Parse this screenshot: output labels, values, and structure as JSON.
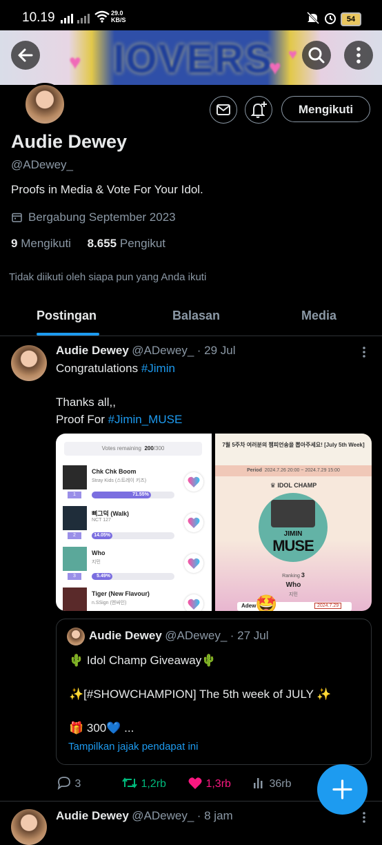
{
  "status_bar": {
    "time": "10.19",
    "net_speed_value": "29.0",
    "net_speed_unit": "KB/S",
    "battery": "54"
  },
  "banner": {
    "text": "IOVERS"
  },
  "profile": {
    "name": "Audie Dewey",
    "handle": "@ADewey_",
    "bio": "Proofs in Media & Vote For Your Idol.",
    "joined": "Bergabung September 2023",
    "following_count": "9",
    "following_label": "Mengikuti",
    "followers_count": "8.655",
    "followers_label": "Pengikut",
    "follow_button": "Mengikuti",
    "followed_by": "Tidak diikuti oleh siapa pun yang Anda ikuti"
  },
  "tabs": [
    "Postingan",
    "Balasan",
    "Media"
  ],
  "tweet": {
    "name": "Audie Dewey",
    "handle": "@ADewey_",
    "date": "· 29 Jul",
    "line1_prefix": "Congratulations ",
    "line1_tag": "#Jimin",
    "line2": "Thanks all,,",
    "line3_prefix": "Proof For ",
    "line3_tag": "#Jimin_MUSE",
    "media_left": {
      "votes_label": "Votes remaining",
      "votes_value": "200",
      "votes_total": "/300",
      "rows": [
        {
          "rank": "1",
          "title": "Chk Chk Boom",
          "artist": "Stray Kids (스트레이 키즈)",
          "pct": "71.55%",
          "frac": 0.7155
        },
        {
          "rank": "2",
          "title": "삐그덕 (Walk)",
          "artist": "NCT 127",
          "pct": "14.05%",
          "frac": 0.1405
        },
        {
          "rank": "3",
          "title": "Who",
          "artist": "지민",
          "pct": "5.49%",
          "frac": 0.0549
        },
        {
          "rank": "",
          "title": "Tiger (New Flavour)",
          "artist": "n.SSign (엔싸인)",
          "pct": "",
          "frac": 0
        }
      ]
    },
    "media_right": {
      "header": "7월 5주차 여러분의 챔피언송을 뽑아주세요! [July 5th Week]",
      "period_label": "Period",
      "period_value": "2024.7.26 20:00 ~ 2024.7.29 15:00",
      "brand": "IDOL CHAMP",
      "album_line1": "JIMIN",
      "album_line2": "MUSE",
      "ranking_label": "Ranking",
      "ranking_value": "3",
      "song": "Who",
      "artist": "지민",
      "footer_left": "Adew",
      "footer_date": "2024.7.29"
    },
    "quote": {
      "name": "Audie Dewey",
      "handle": "@ADewey_",
      "date": "· 27 Jul",
      "line1": "🌵 Idol Champ Giveaway🌵",
      "line2": "✨[#SHOWCHAMPION] The 5th week of JULY ✨",
      "line3": "🎁 300💙 ...",
      "poll_link": "Tampilkan jajak pendapat ini"
    },
    "actions": {
      "replies": "3",
      "retweets": "1,2rb",
      "likes": "1,3rb",
      "views": "36rb"
    }
  },
  "tweet2": {
    "name": "Audie Dewey",
    "handle": "@ADewey_",
    "date": "· 8 jam"
  },
  "colors": {
    "accent": "#1d9bf0",
    "retweet": "#00ba7c",
    "like": "#f91880",
    "muted": "#8b98a5"
  }
}
